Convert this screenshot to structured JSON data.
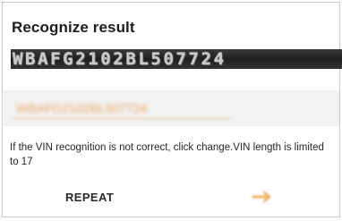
{
  "dialog": {
    "title": "Recognize result",
    "vin_image_text": "WBAFG2102BL507724",
    "input": {
      "value": "WBAFG2102BL507724",
      "accent_color": "#f0a460"
    },
    "hint": "If the VIN recognition is not correct, click change.VIN length is limited to 17",
    "buttons": {
      "repeat_label": "REPEAT",
      "confirm_icon": "arrow-right-icon",
      "confirm_color": "#f0b060"
    }
  }
}
